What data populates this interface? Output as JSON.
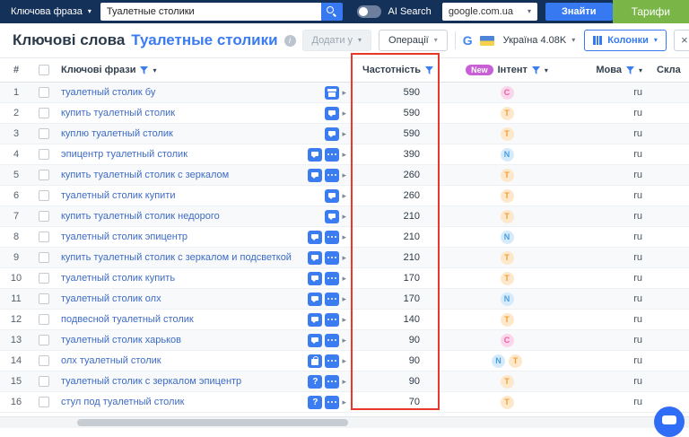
{
  "topbar": {
    "phrase_type": "Ключова фраза",
    "search_value": "Туалетные столики",
    "ai_search_label": "AI Search",
    "search_engine": "google.com.ua",
    "find_button": "Знайти",
    "pricing_button": "Тарифи"
  },
  "toolbar": {
    "title_prefix": "Ключові слова",
    "title_keyword": "Туалетные столики",
    "add_button": "Додати у",
    "operations_button": "Операції",
    "region_label": "Україна 4.08K",
    "columns_button": "Колонки",
    "close_label": "×"
  },
  "table": {
    "headers": {
      "num": "#",
      "phrases": "Ключові фрази",
      "frequency": "Частотність",
      "new_badge": "New",
      "intent": "Інтент",
      "language": "Мова",
      "difficulty": "Скла"
    },
    "rows": [
      {
        "num": "1",
        "phrase": "туалетный столик бу",
        "frequency": "590",
        "intents": [
          "C"
        ],
        "language": "ru",
        "icons": [
          "store"
        ]
      },
      {
        "num": "2",
        "phrase": "купить туалетный столик",
        "frequency": "590",
        "intents": [
          "T"
        ],
        "language": "ru",
        "icons": [
          "chat"
        ]
      },
      {
        "num": "3",
        "phrase": "куплю туалетный столик",
        "frequency": "590",
        "intents": [
          "T"
        ],
        "language": "ru",
        "icons": [
          "chat"
        ]
      },
      {
        "num": "4",
        "phrase": "эпицентр туалетный столик",
        "frequency": "390",
        "intents": [
          "N"
        ],
        "language": "ru",
        "icons": [
          "chat",
          "more"
        ]
      },
      {
        "num": "5",
        "phrase": "купить туалетный столик с зеркалом",
        "frequency": "260",
        "intents": [
          "T"
        ],
        "language": "ru",
        "icons": [
          "chat",
          "more"
        ]
      },
      {
        "num": "6",
        "phrase": "туалетный столик купити",
        "frequency": "260",
        "intents": [
          "T"
        ],
        "language": "ru",
        "icons": [
          "chat"
        ]
      },
      {
        "num": "7",
        "phrase": "купить туалетный столик недорого",
        "frequency": "210",
        "intents": [
          "T"
        ],
        "language": "ru",
        "icons": [
          "chat"
        ]
      },
      {
        "num": "8",
        "phrase": "туалетный столик эпицентр",
        "frequency": "210",
        "intents": [
          "N"
        ],
        "language": "ru",
        "icons": [
          "chat",
          "more"
        ]
      },
      {
        "num": "9",
        "phrase": "купить туалетный столик с зеркалом и подсветкой",
        "frequency": "210",
        "intents": [
          "T"
        ],
        "language": "ru",
        "icons": [
          "chat",
          "more"
        ]
      },
      {
        "num": "10",
        "phrase": "туалетный столик купить",
        "frequency": "170",
        "intents": [
          "T"
        ],
        "language": "ru",
        "icons": [
          "chat",
          "more"
        ]
      },
      {
        "num": "11",
        "phrase": "туалетный столик олх",
        "frequency": "170",
        "intents": [
          "N"
        ],
        "language": "ru",
        "icons": [
          "chat",
          "more"
        ]
      },
      {
        "num": "12",
        "phrase": "подвесной туалетный столик",
        "frequency": "140",
        "intents": [
          "T"
        ],
        "language": "ru",
        "icons": [
          "chat",
          "more"
        ]
      },
      {
        "num": "13",
        "phrase": "туалетный столик харьков",
        "frequency": "90",
        "intents": [
          "C"
        ],
        "language": "ru",
        "icons": [
          "chat",
          "more"
        ]
      },
      {
        "num": "14",
        "phrase": "олх туалетный столик",
        "frequency": "90",
        "intents": [
          "N",
          "T"
        ],
        "language": "ru",
        "icons": [
          "bag",
          "more"
        ]
      },
      {
        "num": "15",
        "phrase": "туалетный столик с зеркалом эпицентр",
        "frequency": "90",
        "intents": [
          "T"
        ],
        "language": "ru",
        "icons": [
          "question",
          "more"
        ]
      },
      {
        "num": "16",
        "phrase": "стул под туалетный столик",
        "frequency": "70",
        "intents": [
          "T"
        ],
        "language": "ru",
        "icons": [
          "question",
          "more"
        ]
      }
    ]
  },
  "colors": {
    "accent_blue": "#3679f0",
    "topbar_navy": "#14315a",
    "pricing_green": "#79b647",
    "annotation_red": "#e6392a",
    "intent_c": "#e75ca8",
    "intent_t": "#ef9f33",
    "intent_n": "#4a9ede",
    "new_badge": "#c95fd6"
  }
}
